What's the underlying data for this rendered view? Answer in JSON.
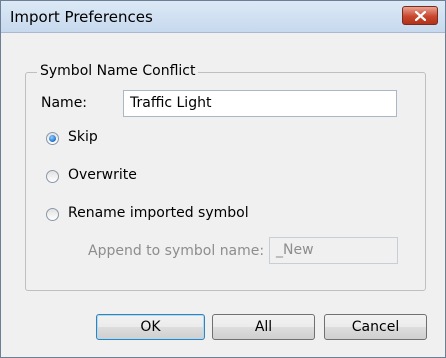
{
  "window": {
    "title": "Import Preferences"
  },
  "group": {
    "title": "Symbol Name Conflict"
  },
  "name_field": {
    "label": "Name:",
    "value": "Traffic Light"
  },
  "options": [
    {
      "label": "Skip",
      "selected": true
    },
    {
      "label": "Overwrite",
      "selected": false
    },
    {
      "label": "Rename imported symbol",
      "selected": false
    }
  ],
  "append": {
    "label": "Append to symbol name:",
    "value": "_New"
  },
  "buttons": {
    "ok": "OK",
    "all": "All",
    "cancel": "Cancel"
  },
  "colors": {
    "titlebar": "#c7d9ee",
    "close": "#c9472f",
    "accent": "#1f6fcf"
  }
}
